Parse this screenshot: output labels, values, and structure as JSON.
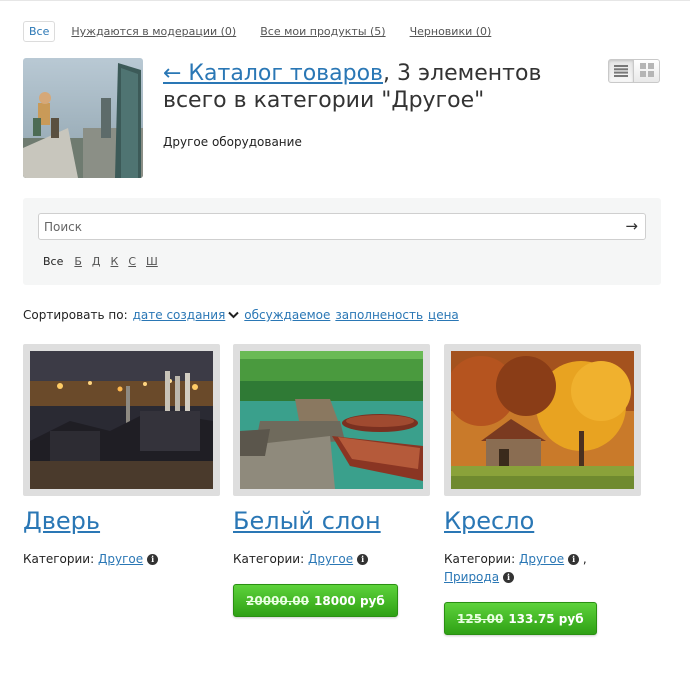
{
  "filters": [
    {
      "label": "Все",
      "active": true
    },
    {
      "label": "Нуждаются в модерации (0)",
      "active": false
    },
    {
      "label": "Все мои продукты (5)",
      "active": false
    },
    {
      "label": "Черновики (0)",
      "active": false
    }
  ],
  "header": {
    "back_link": "← Каталог товаров",
    "title_rest": ", 3 элементов всего в категории \"Другое\"",
    "subtitle": "Другое оборудование"
  },
  "view_modes": [
    {
      "icon": "list-view-icon",
      "active": true
    },
    {
      "icon": "grid-view-icon",
      "active": false
    }
  ],
  "search": {
    "placeholder": "Поиск",
    "value": "",
    "submit_icon": "arrow-right-icon",
    "letters_all": "Все",
    "letters": [
      "Б",
      "Д",
      "К",
      "С",
      "Ш"
    ]
  },
  "sort": {
    "label": "Сортировать по:",
    "options": [
      "дате создания",
      "обсуждаемое",
      "заполненость",
      "цена"
    ]
  },
  "products": [
    {
      "title": "Дверь",
      "cat_label": "Категории:",
      "cats": [
        "Другое"
      ],
      "price_old": "",
      "price_new": ""
    },
    {
      "title": "Белый слон",
      "cat_label": "Категории:",
      "cats": [
        "Другое"
      ],
      "price_old": "20000.00",
      "price_new": "18000 руб"
    },
    {
      "title": "Кресло",
      "cat_label": "Категории:",
      "cats": [
        "Другое",
        "Природа"
      ],
      "price_old": "125.00",
      "price_new": "133.75 руб"
    }
  ],
  "colors": {
    "link": "#2a77b5",
    "price_button": "#3cb422",
    "panel_bg": "#f5f6f6"
  }
}
